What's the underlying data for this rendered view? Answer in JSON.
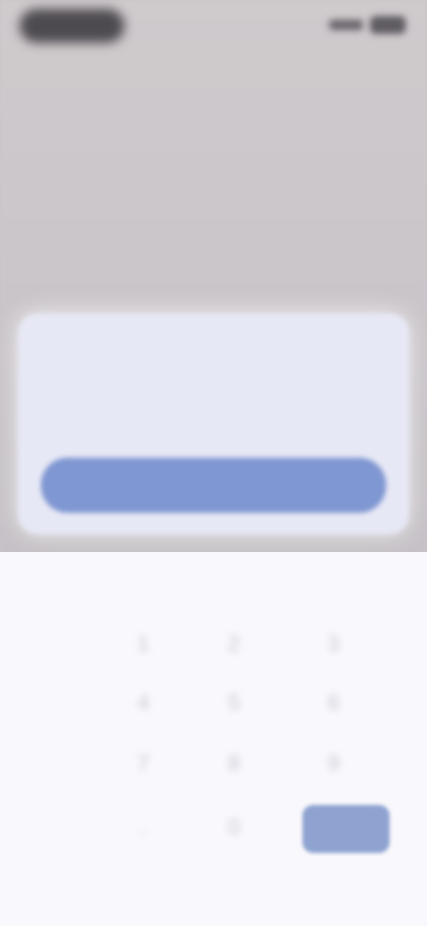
{
  "status_bar": {
    "signal_icon": "signal-bars-icon",
    "battery_icon": "battery-icon"
  },
  "background": {
    "title": "",
    "subtitle": "",
    "section_label": ""
  },
  "modal": {
    "title": "",
    "body": "",
    "button_label": ""
  },
  "keypad": {
    "title": "",
    "keys": [
      "1",
      "2",
      "3",
      "4",
      "5",
      "6",
      "7",
      "8",
      "9",
      ".",
      "0",
      "⌫"
    ],
    "left_column": [
      "",
      "",
      "",
      ""
    ],
    "confirm_label": ""
  },
  "colors": {
    "accent": "#7f97d2",
    "modal_bg": "#e7e8f5",
    "sheet_bg": "#f9f8fc"
  }
}
